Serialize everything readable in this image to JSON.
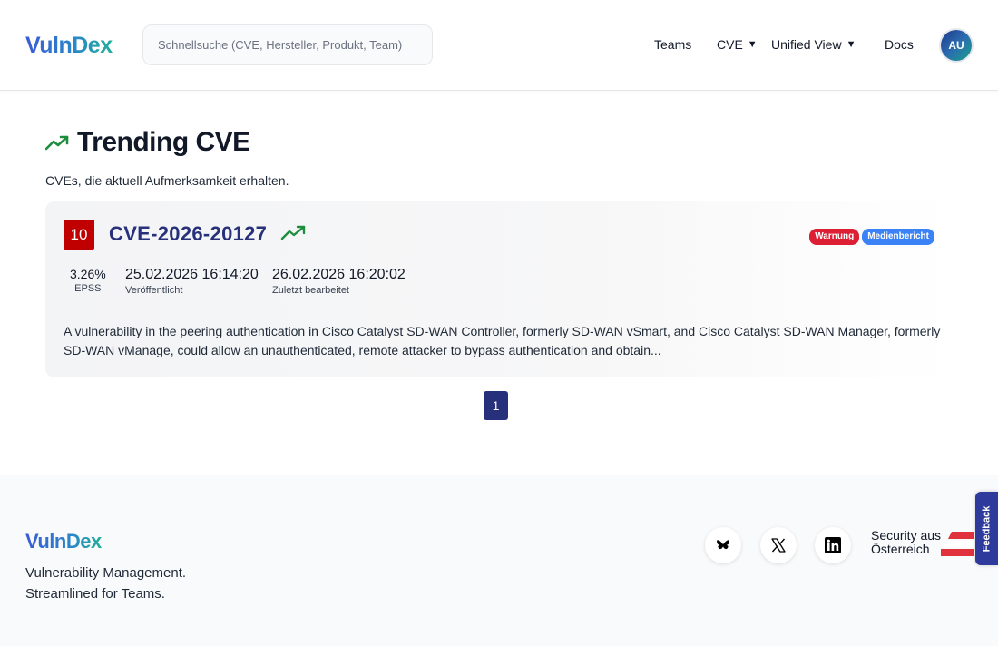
{
  "header": {
    "logo": "VulnDex",
    "search_placeholder": "Schnellsuche (CVE, Hersteller, Produkt, Team)",
    "nav": {
      "teams": "Teams",
      "cve": "CVE",
      "unified_view": "Unified View",
      "docs": "Docs"
    },
    "avatar_initials": "AU"
  },
  "main": {
    "title": "Trending CVE",
    "subtitle": "CVEs, die aktuell Aufmerksamkeit erhalten.",
    "cards": [
      {
        "score": "10",
        "cve_id": "CVE-2026-20127",
        "badges": [
          "Warnung",
          "Medienbericht"
        ],
        "epss_value": "3.26%",
        "epss_label": "EPSS",
        "published_value": "25.02.2026 16:14:20",
        "published_label": "Veröffentlicht",
        "edited_value": "26.02.2026 16:20:02",
        "edited_label": "Zuletzt bearbeitet",
        "description": "A vulnerability in the peering authentication in Cisco Catalyst SD-WAN Controller, formerly SD-WAN vSmart, and Cisco Catalyst SD-WAN Manager, formerly SD-WAN vManage, could allow an unauthenticated, remote attacker to bypass authentication and obtain..."
      }
    ],
    "pagination": {
      "current_page": "1"
    }
  },
  "footer": {
    "logo": "VulnDex",
    "tagline_line1": "Vulnerability Management.",
    "tagline_line2": "Streamlined for Teams.",
    "social_icons": [
      "bluesky-icon",
      "x-icon",
      "linkedin-icon"
    ],
    "security_line1": "Security aus",
    "security_line2": "Österreich"
  },
  "feedback_label": "Feedback",
  "colors": {
    "score_critical": "#c00000",
    "cve_link": "#27307a",
    "trend_green": "#1e8e3e",
    "badge_warning": "#dc1f34",
    "badge_media": "#3b82f6",
    "feedback_tab": "#2f3b9c"
  }
}
